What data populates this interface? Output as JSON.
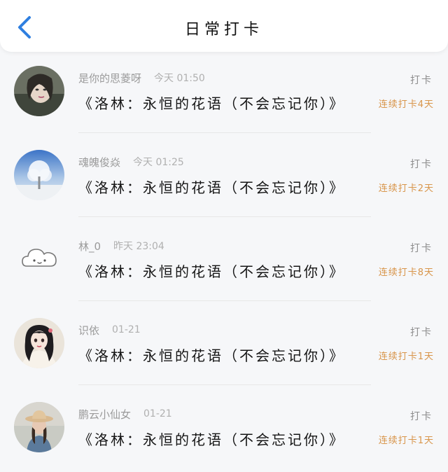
{
  "header": {
    "title": "日常打卡"
  },
  "entries": [
    {
      "username": "是你的思菱呀",
      "time": "今天 01:50",
      "checkin_label": "打卡",
      "book_title": "《洛林：永恒的花语（不会忘记你）》",
      "streak": "连续打卡4天",
      "avatar_icon": "portrait-woman-avatar"
    },
    {
      "username": "魂魄俊焱",
      "time": "今天 01:25",
      "checkin_label": "打卡",
      "book_title": "《洛林：永恒的花语（不会忘记你）》",
      "streak": "连续打卡2天",
      "avatar_icon": "snowy-tree-avatar"
    },
    {
      "username": "林_0",
      "time": "昨天 23:04",
      "checkin_label": "打卡",
      "book_title": "《洛林：永恒的花语（不会忘记你）》",
      "streak": "连续打卡8天",
      "avatar_icon": "cloud-avatar"
    },
    {
      "username": "识依",
      "time": "01-21",
      "checkin_label": "打卡",
      "book_title": "《洛林：永恒的花语（不会忘记你）》",
      "streak": "连续打卡1天",
      "avatar_icon": "anime-girl-avatar"
    },
    {
      "username": "鹏云小仙女",
      "time": "01-21",
      "checkin_label": "打卡",
      "book_title": "《洛林：永恒的花语（不会忘记你）》",
      "streak": "连续打卡1天",
      "avatar_icon": "girl-hat-avatar"
    }
  ],
  "colors": {
    "accent_back": "#2f7fe0",
    "streak": "#d8954a"
  }
}
